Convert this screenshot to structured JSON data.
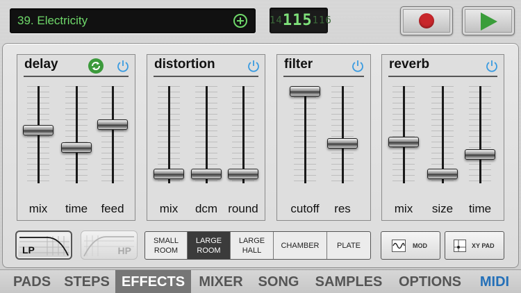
{
  "preset": {
    "name": "39. Electricity"
  },
  "tempo": {
    "ghost_left": "14",
    "value": "115",
    "ghost_right": "116"
  },
  "colors": {
    "accent_green": "#6fd86a",
    "record_red": "#c8262b",
    "play_green": "#3a9d3a",
    "power_blue": "#3a9be0",
    "midi_blue": "#2470b8"
  },
  "effects": {
    "delay": {
      "title": "delay",
      "faders": [
        {
          "label": "mix",
          "level": 0.55
        },
        {
          "label": "time",
          "level": 0.35
        },
        {
          "label": "feed",
          "level": 0.62
        }
      ]
    },
    "distortion": {
      "title": "distortion",
      "faders": [
        {
          "label": "mix",
          "level": 0.05
        },
        {
          "label": "dcm",
          "level": 0.05
        },
        {
          "label": "round",
          "level": 0.05
        }
      ]
    },
    "filter": {
      "title": "filter",
      "faders": [
        {
          "label": "cutoff",
          "level": 1.0
        },
        {
          "label": "res",
          "level": 0.4
        }
      ]
    },
    "reverb": {
      "title": "reverb",
      "faders": [
        {
          "label": "mix",
          "level": 0.42
        },
        {
          "label": "size",
          "level": 0.05
        },
        {
          "label": "time",
          "level": 0.27
        }
      ]
    }
  },
  "filter_types": {
    "lp": "LP",
    "hp": "HP"
  },
  "reverb_rooms": [
    {
      "l1": "SMALL",
      "l2": "ROOM",
      "selected": false
    },
    {
      "l1": "LARGE",
      "l2": "ROOM",
      "selected": true
    },
    {
      "l1": "LARGE",
      "l2": "HALL",
      "selected": false
    },
    {
      "l1": "CHAMBER",
      "l2": "",
      "selected": false
    },
    {
      "l1": "PLATE",
      "l2": "",
      "selected": false
    }
  ],
  "modes": {
    "mod": "MOD",
    "xypad": "XY PAD"
  },
  "tabs": [
    {
      "label": "PADS",
      "active": false
    },
    {
      "label": "STEPS",
      "active": false
    },
    {
      "label": "EFFECTS",
      "active": true
    },
    {
      "label": "MIXER",
      "active": false
    },
    {
      "label": "SONG",
      "active": false
    },
    {
      "label": "SAMPLES",
      "active": false
    },
    {
      "label": "OPTIONS",
      "active": false
    },
    {
      "label": "MIDI",
      "active": false
    }
  ]
}
